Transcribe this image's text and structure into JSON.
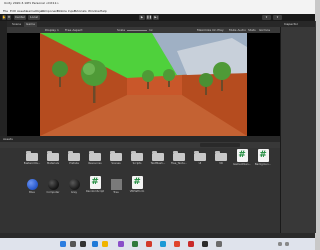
{
  "window": {
    "title": "Unity 2020.3.16f1 Personal <DX11>"
  },
  "menu": {
    "items": [
      "File",
      "Edit",
      "Assets",
      "GameObject",
      "Component",
      "Mobile Input",
      "Tutorials",
      "Window",
      "Help"
    ]
  },
  "toolbar": {
    "pivot": "Center",
    "space": "Local"
  },
  "editor_tabs": {
    "scene": "Scene",
    "game": "Game",
    "inspector": "Inspector"
  },
  "game_toolbar": {
    "display": "Display 1",
    "aspect": "Free Aspect",
    "scale_label": "Scale",
    "scale_value": "1x",
    "options": [
      "Maximize On Play",
      "Mute Audio",
      "Stats",
      "Gizmos"
    ]
  },
  "project": {
    "tab": "Assets",
    "folders": [
      "Eastworlds...",
      "Materials",
      "Prefabs",
      "Resources",
      "Scenes",
      "Scripts",
      "TextMesh...",
      "Tree_Textu...",
      "UI",
      "VR"
    ],
    "scripts": [
      "GameUrben...",
      "Backgroun..."
    ],
    "assets": [
      {
        "label": "Blue",
        "kind": "sphere",
        "color": "#2e5fd1"
      },
      {
        "label": "Computer",
        "kind": "sphere",
        "color": "#1a1a1a"
      },
      {
        "label": "Grey",
        "kind": "sphere",
        "color": "#1f1f1f"
      },
      {
        "label": "RandomScript",
        "kind": "script"
      },
      {
        "label": "Tree",
        "kind": "square",
        "color": "#7a7a7a"
      },
      {
        "label": "VRPlatform",
        "kind": "script"
      }
    ]
  },
  "colors": {
    "accent": "#3b8ee5",
    "sky_green": "#4fd13c",
    "ground": "#b54c1f"
  }
}
